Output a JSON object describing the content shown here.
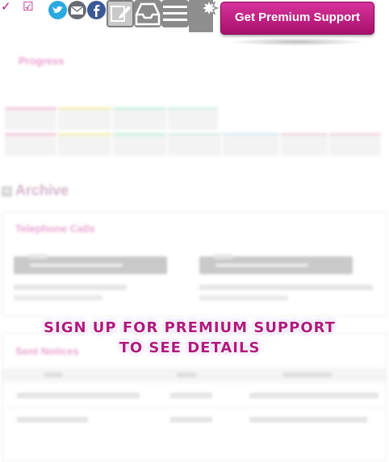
{
  "toolbar": {
    "icons": [
      "check-icon",
      "checkbox-check-icon",
      "twitter-icon",
      "email-icon",
      "facebook-icon",
      "edit-icon",
      "inbox-icon",
      "list-icon",
      "new-document-icon"
    ],
    "premium_button_label": "Get Premium Support"
  },
  "progress": {
    "title": "Progress"
  },
  "archive": {
    "title": "Archive"
  },
  "telephone_calls": {
    "title": "Telephone Calls"
  },
  "sent_notices": {
    "title": "Sent Notices"
  },
  "overlay": {
    "line1": "SIGN UP FOR PREMIUM SUPPORT",
    "line2": "TO SEE DETAILS"
  },
  "colors": {
    "accent": "#b01a7e",
    "button_top": "#d6339b",
    "button_bottom": "#a8106c",
    "section_title": "#e9a7d2"
  }
}
